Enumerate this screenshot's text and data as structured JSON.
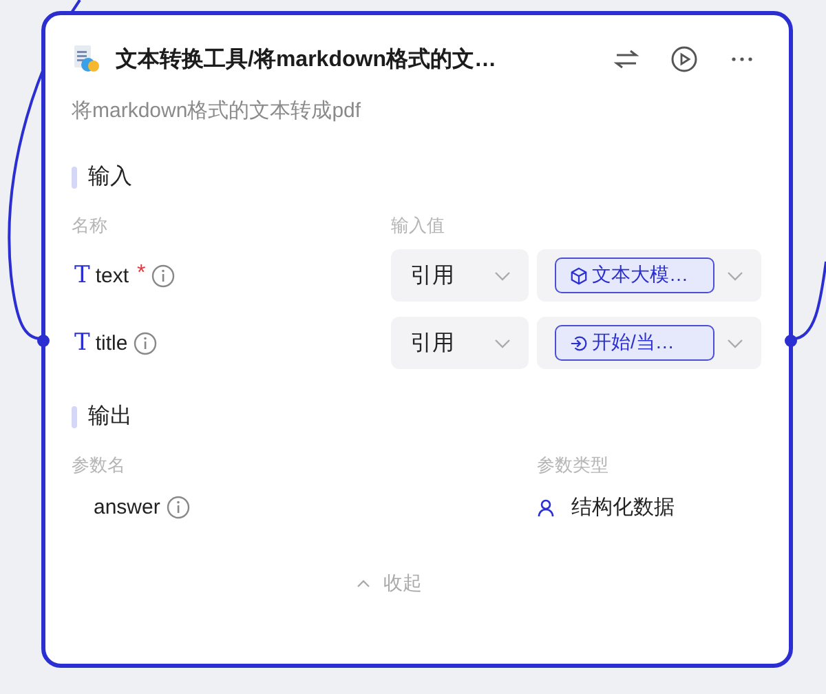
{
  "node": {
    "title": "文本转换工具/将markdown格式的文…",
    "description": "将markdown格式的文本转成pdf"
  },
  "input": {
    "heading": "输入",
    "columns": [
      "名称",
      "输入值"
    ],
    "params": [
      {
        "type_glyph": "T",
        "name": "text",
        "required_mark": "*",
        "mode": "引用",
        "kind": "model",
        "ref": "文本大模…"
      },
      {
        "type_glyph": "T",
        "name": "title",
        "mode": "引用",
        "kind": "start",
        "ref": "开始/当…"
      }
    ]
  },
  "output": {
    "heading": "输出",
    "columns": [
      "参数名",
      "参数类型"
    ],
    "params": [
      {
        "name": "answer",
        "type": "结构化数据"
      }
    ]
  },
  "collapse": {
    "label": "收起"
  }
}
